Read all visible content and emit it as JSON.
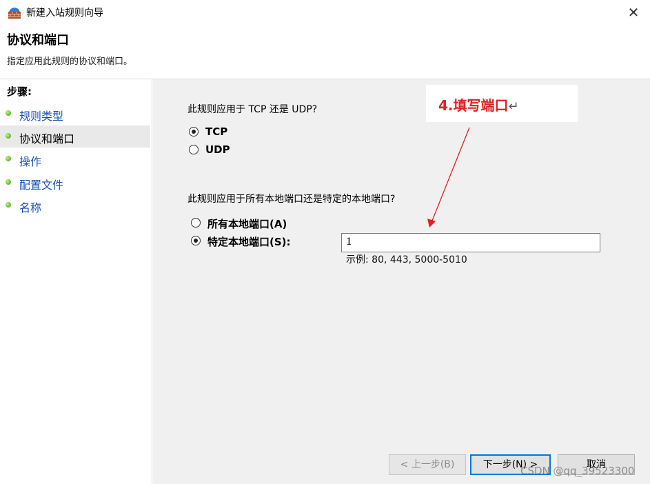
{
  "window": {
    "title": "新建入站规则向导",
    "close_glyph": "✕",
    "app_icon": "firewall-wall-icon"
  },
  "header": {
    "title": "协议和端口",
    "description": "指定应用此规则的协议和端口。"
  },
  "sidebar": {
    "steps_label": "步骤:",
    "items": [
      {
        "label": "规则类型",
        "active": false
      },
      {
        "label": "协议和端口",
        "active": true
      },
      {
        "label": "操作",
        "active": false
      },
      {
        "label": "配置文件",
        "active": false
      },
      {
        "label": "名称",
        "active": false
      }
    ]
  },
  "main": {
    "protocol_question": "此规则应用于 TCP 还是 UDP?",
    "protocol_options": [
      {
        "label": "TCP",
        "checked": true
      },
      {
        "label": "UDP",
        "checked": false
      }
    ],
    "port_question": "此规则应用于所有本地端口还是特定的本地端口?",
    "port_options": [
      {
        "label": "所有本地端口(A)",
        "checked": false
      },
      {
        "label": "特定本地端口(S):",
        "checked": true
      }
    ],
    "port_value": "1",
    "port_example": "示例: 80, 443, 5000-5010"
  },
  "annotation": {
    "text": "4.填写端口",
    "mark": "↵",
    "color": "#e02020"
  },
  "buttons": {
    "back": "< 上一步(B)",
    "next": "下一步(N) >",
    "cancel": "取消"
  },
  "watermark": "CSDN @qq_39523300"
}
